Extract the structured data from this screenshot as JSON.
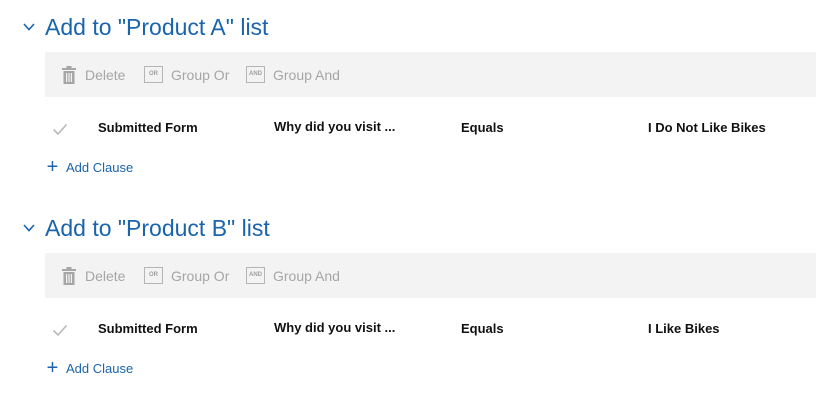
{
  "sections": [
    {
      "title": "Add to \"Product A\" list",
      "toolbar": {
        "delete_label": "Delete",
        "group_or_label": "Group Or",
        "group_and_label": "Group And",
        "or_icon_text": "OR",
        "and_icon_text": "AND"
      },
      "clause": {
        "field": "Submitted Form",
        "question": "Why did you visit ...",
        "operator": "Equals",
        "value": "I Do Not Like Bikes"
      },
      "add_clause_label": "Add Clause"
    },
    {
      "title": "Add to \"Product B\" list",
      "toolbar": {
        "delete_label": "Delete",
        "group_or_label": "Group Or",
        "group_and_label": "Group And",
        "or_icon_text": "OR",
        "and_icon_text": "AND"
      },
      "clause": {
        "field": "Submitted Form",
        "question": "Why did you visit ...",
        "operator": "Equals",
        "value": "I Like Bikes"
      },
      "add_clause_label": "Add Clause"
    }
  ],
  "colors": {
    "accent": "#1a64ad",
    "toolbar_bg": "#f3f3f3",
    "disabled_text": "#a6a6a6"
  },
  "icons": {
    "collapse": "chevron-down-icon",
    "delete": "trash-icon",
    "group_or": "group-or-icon",
    "group_and": "group-and-icon",
    "row_check": "checkmark-icon",
    "add": "plus-icon"
  }
}
